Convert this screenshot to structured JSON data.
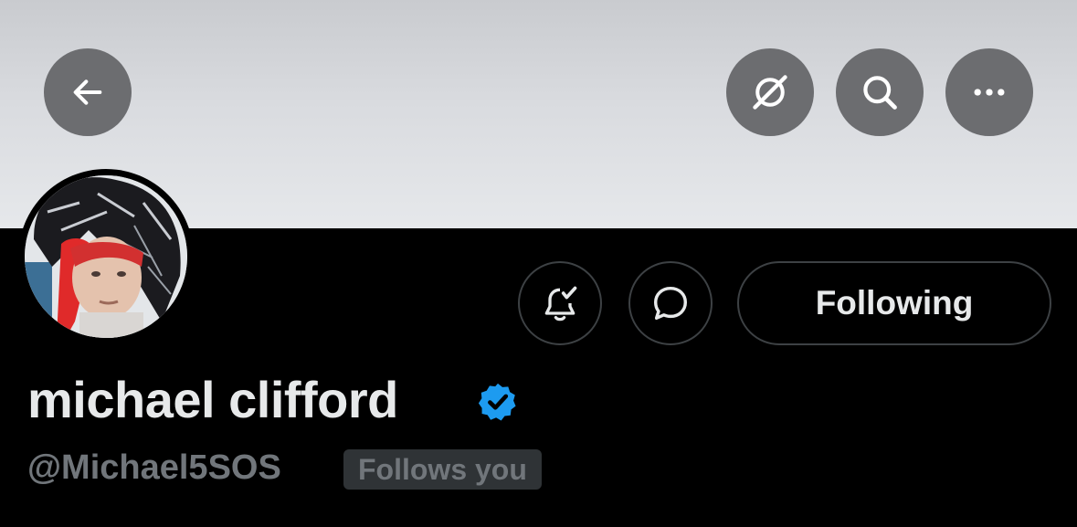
{
  "header": {
    "back_icon": "arrow-left-icon",
    "grok_icon": "grok-icon",
    "search_icon": "search-icon",
    "more_icon": "more-horizontal-icon"
  },
  "profile": {
    "display_name": "michael clifford",
    "verified": true,
    "verified_color": "#1d9bf0",
    "handle": "@Michael5SOS",
    "follows_you": "Follows you",
    "following_label": "Following",
    "notifications_icon": "bell-check-icon",
    "message_icon": "message-bubble-icon"
  },
  "colors": {
    "background": "#000000",
    "text_primary": "#e7e9ea",
    "text_secondary": "#71767b",
    "banner": "#d9dbdf"
  }
}
